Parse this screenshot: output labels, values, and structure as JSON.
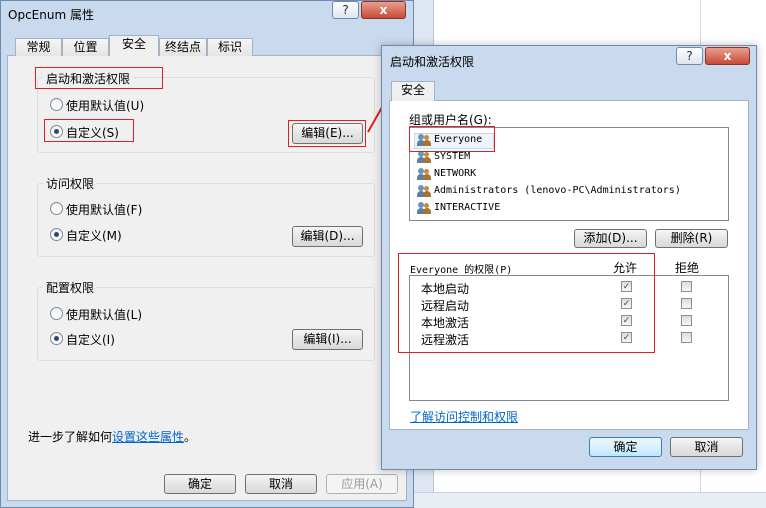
{
  "background": {},
  "props_window": {
    "title": "OpcEnum 属性",
    "help": "?",
    "close": "x",
    "tabs": [
      "常规",
      "位置",
      "安全",
      "终结点",
      "标识"
    ],
    "groups": [
      {
        "title": "启动和激活权限",
        "opt_default": "使用默认值(U)",
        "opt_custom": "自定义(S)",
        "edit": "编辑(E)..."
      },
      {
        "title": "访问权限",
        "opt_default": "使用默认值(F)",
        "opt_custom": "自定义(M)",
        "edit": "编辑(D)..."
      },
      {
        "title": "配置权限",
        "opt_default": "使用默认值(L)",
        "opt_custom": "自定义(I)",
        "edit": "编辑(I)..."
      }
    ],
    "learn_prefix": "进一步了解如何",
    "learn_link": "设置这些属性",
    "learn_suffix": "。",
    "ok": "确定",
    "cancel": "取消",
    "apply": "应用(A)"
  },
  "perm_window": {
    "title": "启动和激活权限",
    "help": "?",
    "close": "x",
    "tab": "安全",
    "users_label": "组或用户名(G):",
    "users": [
      "Everyone",
      "SYSTEM",
      "NETWORK",
      "Administrators (lenovo-PC\\Administrators)",
      "INTERACTIVE"
    ],
    "add": "添加(D)...",
    "remove": "删除(R)",
    "perm_header": "Everyone 的权限(P)",
    "allow": "允许",
    "deny": "拒绝",
    "permissions": [
      {
        "name": "本地启动",
        "allow": true,
        "deny": false
      },
      {
        "name": "远程启动",
        "allow": true,
        "deny": false
      },
      {
        "name": "本地激活",
        "allow": true,
        "deny": false
      },
      {
        "name": "远程激活",
        "allow": true,
        "deny": false
      }
    ],
    "learn_link": "了解访问控制和权限",
    "ok": "确定",
    "cancel": "取消"
  },
  "annotation_color": "#e02020",
  "checkmark": "✓"
}
